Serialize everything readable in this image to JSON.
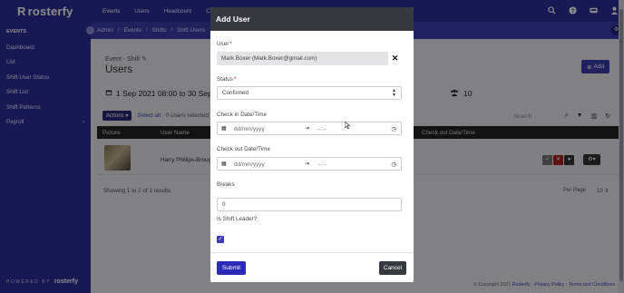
{
  "brand": {
    "name": "rosterfy",
    "footer_prefix": "POWERED BY",
    "footer_brand": "rosterfy"
  },
  "sidebar": {
    "section": "EVENTS",
    "items": [
      {
        "label": "Dashboard"
      },
      {
        "label": "List"
      },
      {
        "label": "Shift User Status"
      },
      {
        "label": "Shift List"
      },
      {
        "label": "Shift Patterns"
      },
      {
        "label": "Payroll",
        "chevron": "›"
      }
    ]
  },
  "topnav": {
    "items": [
      "Events",
      "Users",
      "Headcount",
      "Comm"
    ]
  },
  "breadcrumb": [
    "Admin",
    "Events",
    "Shifts",
    "Shift Users"
  ],
  "page": {
    "event_label": "Event - Shift",
    "heading": "Users",
    "add_label": "Add",
    "date_range": "1 Sep 2021 08:00 to 30 Sep 20",
    "people_count": "10",
    "actions_label": "Actions",
    "select_all": "Select all",
    "selected_count": "0 Users selected",
    "search_placeholder": "Search",
    "columns": {
      "picture": "Picture",
      "user_name": "User Name",
      "check_out": "Check out Date/Time"
    },
    "row_name": "Harry Phillips-Brough",
    "showing": "Showing 1 to 1 of 1 results",
    "per_page_label": "Per Page",
    "per_page_value": "10",
    "copyright": "© Copyright 2021",
    "copyright_brand": "Rosterfy",
    "privacy": "Privacy Policy",
    "terms": "Terms and Conditions"
  },
  "modal": {
    "title": "Add User",
    "user_label": "User",
    "user_value": "Mark Boxer (Mark.Boxer@gmail.com)",
    "status_label": "Status",
    "status_value": "Confirmed",
    "checkin_label": "Check in Date/Time",
    "checkin_date_placeholder": "dd/mm/yyyy",
    "checkin_time_placeholder": "--:--",
    "checkout_label": "Check out Date/Time",
    "checkout_date_placeholder": "dd/mm/yyyy",
    "checkout_time_placeholder": "--:--",
    "breaks_label": "Breaks",
    "breaks_value": "0",
    "shift_leader_label": "Is Shift Leader?",
    "shift_leader_checked": true,
    "submit_label": "Submit",
    "cancel_label": "Cancel"
  },
  "colors": {
    "primary": "#2c2c9c",
    "modal_header": "#383840",
    "required": "#c0202a"
  },
  "icons": [
    "search-icon",
    "help-icon",
    "inbox-icon",
    "user-icon",
    "calendar-icon",
    "clock-icon",
    "users-icon",
    "filter-icon",
    "columns-icon",
    "refresh-icon",
    "gear-icon",
    "close-icon",
    "edit-icon"
  ]
}
